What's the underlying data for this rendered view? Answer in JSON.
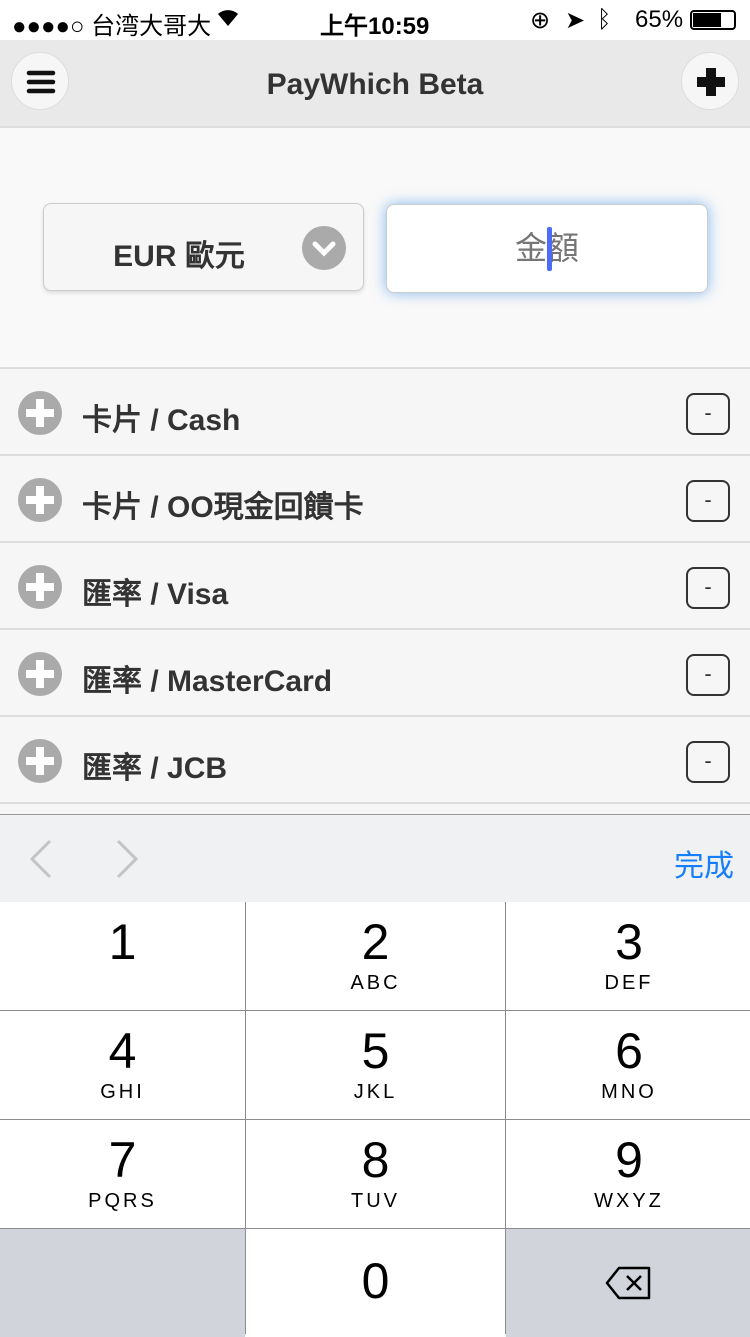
{
  "status": {
    "carrier": "●●●●○ 台湾大哥大",
    "time": "上午10:59",
    "battery": "65%"
  },
  "header": {
    "title": "PayWhich Beta",
    "menu_icon": "hamburger-icon",
    "add_icon": "plus-icon"
  },
  "form": {
    "currency": "EUR 歐元",
    "amount_placeholder": "金額",
    "amount_value": ""
  },
  "list": [
    {
      "label": "卡片 / Cash"
    },
    {
      "label": "卡片 / OO現金回饋卡"
    },
    {
      "label": "匯率 / Visa"
    },
    {
      "label": "匯率 / MasterCard"
    },
    {
      "label": "匯率 / JCB"
    }
  ],
  "remove_label": "-",
  "toolbar": {
    "done": "完成"
  },
  "keypad": [
    {
      "n": "1",
      "l": ""
    },
    {
      "n": "2",
      "l": "ABC"
    },
    {
      "n": "3",
      "l": "DEF"
    },
    {
      "n": "4",
      "l": "GHI"
    },
    {
      "n": "5",
      "l": "JKL"
    },
    {
      "n": "6",
      "l": "MNO"
    },
    {
      "n": "7",
      "l": "PQRS"
    },
    {
      "n": "8",
      "l": "TUV"
    },
    {
      "n": "9",
      "l": "WXYZ"
    },
    {
      "n": "0",
      "l": ""
    }
  ],
  "colors": {
    "accent": "#157efb",
    "caret": "#4a6cf7"
  }
}
